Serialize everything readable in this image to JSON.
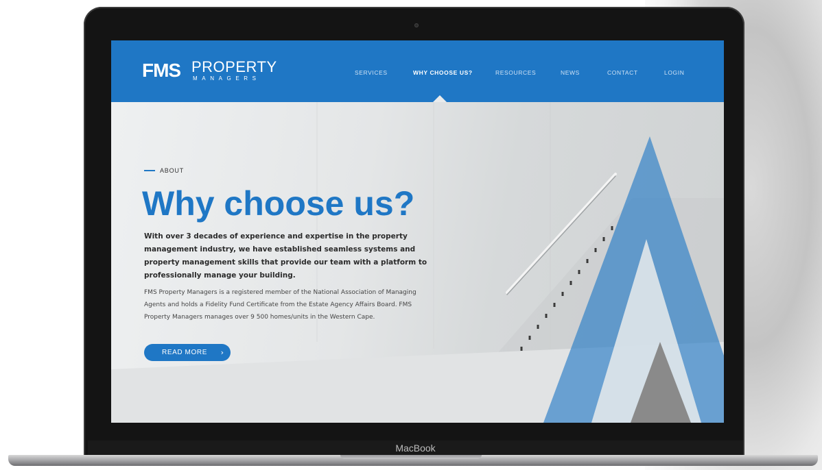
{
  "device": {
    "brand_label": "MacBook"
  },
  "site": {
    "logo": {
      "word1": "FMS",
      "word2": "PROPERTY",
      "word3": "MANAGERS"
    },
    "nav": {
      "items": [
        {
          "label": "SERVICES",
          "active": false
        },
        {
          "label": "WHY CHOOSE US?",
          "active": true
        },
        {
          "label": "RESOURCES",
          "active": false
        },
        {
          "label": "NEWS",
          "active": false
        },
        {
          "label": "CONTACT",
          "active": false
        },
        {
          "label": "LOGIN",
          "active": false
        }
      ]
    },
    "hero": {
      "eyebrow": "ABOUT",
      "title": "Why choose us?",
      "lead": "With over 3 decades of experience and expertise in the property management industry, we have established seamless systems and property management skills that provide our team with a platform to professionally manage your building.",
      "body": "FMS Property Managers is a registered member of the National Association of Managing Agents and holds a Fidelity Fund Certificate from the Estate Agency Affairs Board. FMS Property Managers manages over 9 500 homes/units in the Western Cape.",
      "cta_label": "READ MORE",
      "cta_icon": "chevron-right-icon"
    }
  },
  "colors": {
    "brand_blue": "#1f77c5",
    "bezel": "#141414",
    "accent_grey": "#8a8a8a"
  }
}
